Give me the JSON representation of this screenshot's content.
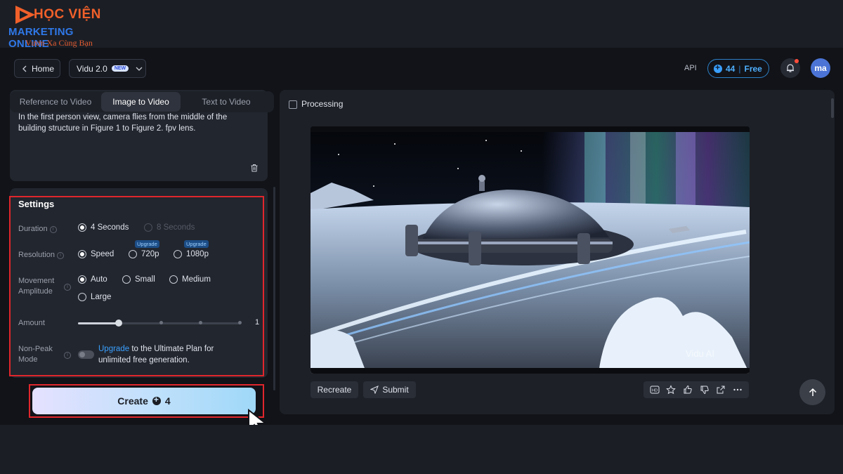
{
  "brand": {
    "line1": "HỌC VIỆN",
    "line2": "MARKETING ONLINE",
    "line3": "Vươn Xa Cùng Bạn"
  },
  "header": {
    "home_label": "Home",
    "model_label": "Vidu 2.0",
    "new_badge": "NEW",
    "api_label": "API",
    "credits_value": "44",
    "credits_separator": "|",
    "credits_plan": "Free",
    "avatar_initials": "ma"
  },
  "tabs": [
    {
      "label": "Reference to Video",
      "active": false
    },
    {
      "label": "Image to Video",
      "active": true
    },
    {
      "label": "Text to Video",
      "active": false
    }
  ],
  "prompt": {
    "text": "In the first person view, camera flies from the middle of the building structure in Figure 1 to Figure 2. fpv lens."
  },
  "settings": {
    "title": "Settings",
    "duration": {
      "label": "Duration",
      "options": [
        {
          "label": "4 Seconds",
          "selected": true,
          "disabled": false
        },
        {
          "label": "8 Seconds",
          "selected": false,
          "disabled": true
        }
      ]
    },
    "resolution": {
      "label": "Resolution",
      "options": [
        {
          "label": "Speed",
          "selected": true,
          "badge": ""
        },
        {
          "label": "720p",
          "selected": false,
          "badge": "Upgrade"
        },
        {
          "label": "1080p",
          "selected": false,
          "badge": "Upgrade"
        }
      ]
    },
    "movement": {
      "label_line1": "Movement",
      "label_line2": "Amplitude",
      "options": [
        {
          "label": "Auto",
          "selected": true
        },
        {
          "label": "Small",
          "selected": false
        },
        {
          "label": "Medium",
          "selected": false
        },
        {
          "label": "Large",
          "selected": false
        }
      ]
    },
    "amount": {
      "label": "Amount",
      "value": "1",
      "slider_fraction": 0.25
    },
    "non_peak": {
      "label_line1": "Non-Peak",
      "label_line2": "Mode",
      "enabled": false,
      "link_text": "Upgrade",
      "rest_text": " to the Ultimate Plan for unlimited free generation."
    }
  },
  "create": {
    "label": "Create",
    "cost": "4"
  },
  "result": {
    "processing_label": "Processing",
    "watermark": "Vidu AI",
    "recreate_label": "Recreate",
    "submit_label": "Submit"
  },
  "colors": {
    "accent_blue": "#3aa0ff",
    "highlight_red": "#e0262c",
    "brand_orange": "#f0602a",
    "brand_blue": "#2f78e8"
  }
}
